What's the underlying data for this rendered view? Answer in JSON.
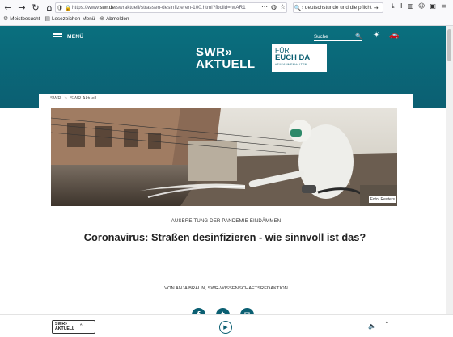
{
  "browser": {
    "back_icon": "←",
    "forward_icon": "→",
    "reload_icon": "↻",
    "home_icon": "⌂",
    "url_prefix": "https://www.",
    "url_domain": "swr.de",
    "url_rest": "/swraktuell/strassen-desinfizieren-100.html?fbclid=IwAR1",
    "search_text": "› deutschstunde und die pflicht",
    "bookmarks": [
      {
        "icon": "⚙",
        "label": "Meistbesucht"
      },
      {
        "icon": "▤",
        "label": "Lesezeichen-Menü"
      },
      {
        "icon": "⊕",
        "label": "Abmelden"
      }
    ]
  },
  "header": {
    "menu_label": "MENÜ",
    "search_placeholder": "Suche",
    "logo_line1": "SWR»",
    "logo_line2": "AKTUELL",
    "badge_line1": "FÜR",
    "badge_line2": "EUCH DA",
    "badge_line3": "#ZUSAMMENHALTEN"
  },
  "breadcrumb": {
    "items": [
      "SWR",
      "SWR Aktuell"
    ],
    "separator": ">"
  },
  "article": {
    "photo_credit": "Foto: Reuters",
    "kicker": "AUSBREITUNG DER PANDEMIE EINDÄMMEN",
    "headline": "Coronavirus: Straßen desinfizieren - wie sinnvoll ist das?",
    "author": "VON ANJA BRAUN, SWR-WISSENSCHAFTSREDAKTION",
    "share": [
      {
        "icon": "f",
        "name": "facebook"
      },
      {
        "icon": "t",
        "name": "twitter"
      },
      {
        "icon": "✉",
        "name": "email"
      }
    ]
  },
  "player": {
    "logo_line1": "SWR»",
    "logo_line2": "AKTUELL",
    "chevron": "˄",
    "play_icon": "▶",
    "volume_icon": "🔈",
    "up_icon": "˄"
  },
  "colors": {
    "brand": "#0b5f72",
    "hero": "#0a6f7e"
  }
}
